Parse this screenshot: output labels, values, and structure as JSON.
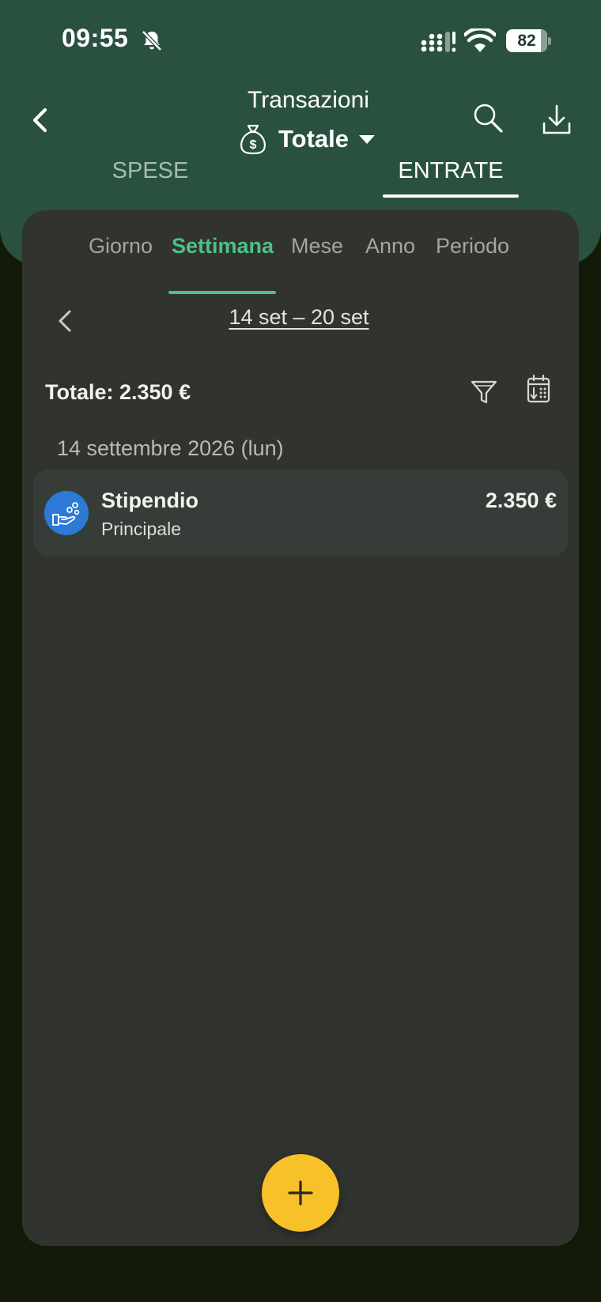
{
  "status_bar": {
    "time": "09:55",
    "battery": "82",
    "icons": [
      "bell-off-icon",
      "signal-icon",
      "wifi-icon",
      "battery-icon"
    ]
  },
  "app_bar": {
    "title": "Transazioni",
    "account": "Totale",
    "icons": [
      "back-arrow-icon",
      "moneybag-icon",
      "caret-down-icon",
      "search-icon",
      "download-icon"
    ]
  },
  "type_tabs": [
    {
      "label": "SPESE",
      "selected": false
    },
    {
      "label": "ENTRATE",
      "selected": true
    }
  ],
  "period_tabs": [
    {
      "label": "Giorno",
      "selected": false
    },
    {
      "label": "Settimana",
      "selected": true
    },
    {
      "label": "Mese",
      "selected": false
    },
    {
      "label": "Anno",
      "selected": false
    },
    {
      "label": "Periodo",
      "selected": false
    }
  ],
  "period_range": "14 set – 20 set",
  "total": "Totale: 2.350 €",
  "list_tool_icons": [
    "filter-icon",
    "calendar-sort-icon"
  ],
  "groups": [
    {
      "date": "14 settembre 2026 (lun)",
      "transactions": [
        {
          "name": "Stipendio",
          "account": "Principale",
          "amount": "2.350 €",
          "icon": "hand-coins-icon",
          "icon_color": "#2c79d6"
        }
      ]
    }
  ],
  "fab_icon": "plus-icon",
  "colors": {
    "header": "#2a5140",
    "accent": "#4cc08d",
    "fab": "#f8c12a",
    "card": "#31332e"
  }
}
